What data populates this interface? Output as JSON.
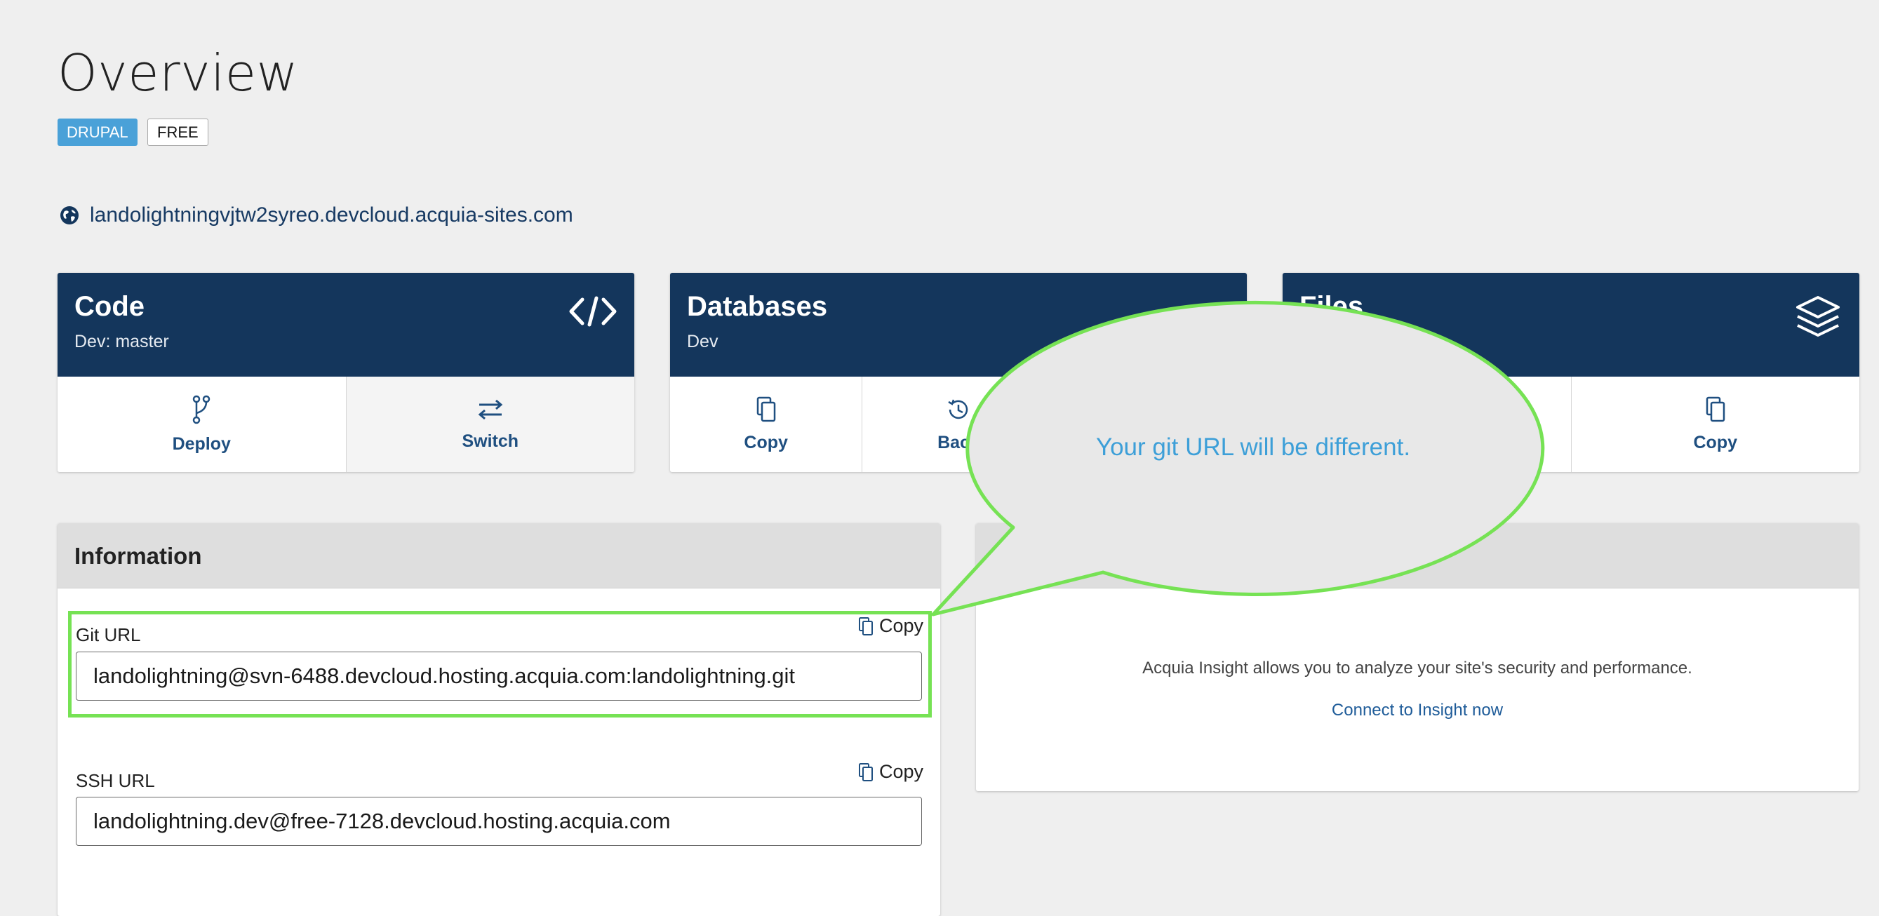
{
  "page": {
    "title": "Overview"
  },
  "badges": {
    "drupal": "DRUPAL",
    "free": "FREE"
  },
  "site": {
    "url": "landolightningvjtw2syreo.devcloud.acquia-sites.com"
  },
  "cards": {
    "code": {
      "title": "Code",
      "subtitle": "Dev:  master",
      "header_icon": "code-brackets-icon",
      "actions": [
        {
          "label": "Deploy",
          "icon": "git-branch-icon"
        },
        {
          "label": "Switch",
          "icon": "switch-arrows-icon"
        }
      ]
    },
    "databases": {
      "title": "Databases",
      "subtitle": "Dev",
      "actions": [
        {
          "label": "Copy",
          "icon": "copy-icon"
        },
        {
          "label": "Back",
          "icon": "backup-history-icon"
        }
      ]
    },
    "files": {
      "title": "Files",
      "header_icon": "layers-icon",
      "actions": [
        {
          "label": "Copy",
          "icon": "copy-icon"
        }
      ]
    }
  },
  "information": {
    "heading": "Information",
    "git": {
      "label": "Git URL",
      "copy_label": "Copy",
      "value": "landolightning@svn-6488.devcloud.hosting.acquia.com:landolightning.git"
    },
    "ssh": {
      "label": "SSH URL",
      "copy_label": "Copy",
      "value": "landolightning.dev@free-7128.devcloud.hosting.acquia.com"
    }
  },
  "insight": {
    "description": "Acquia Insight allows you to analyze your site's security and performance.",
    "link": "Connect to Insight now"
  },
  "callout": {
    "text": "Your git URL will be different.",
    "border_color": "#76e254",
    "text_color": "#3d9fd8"
  }
}
